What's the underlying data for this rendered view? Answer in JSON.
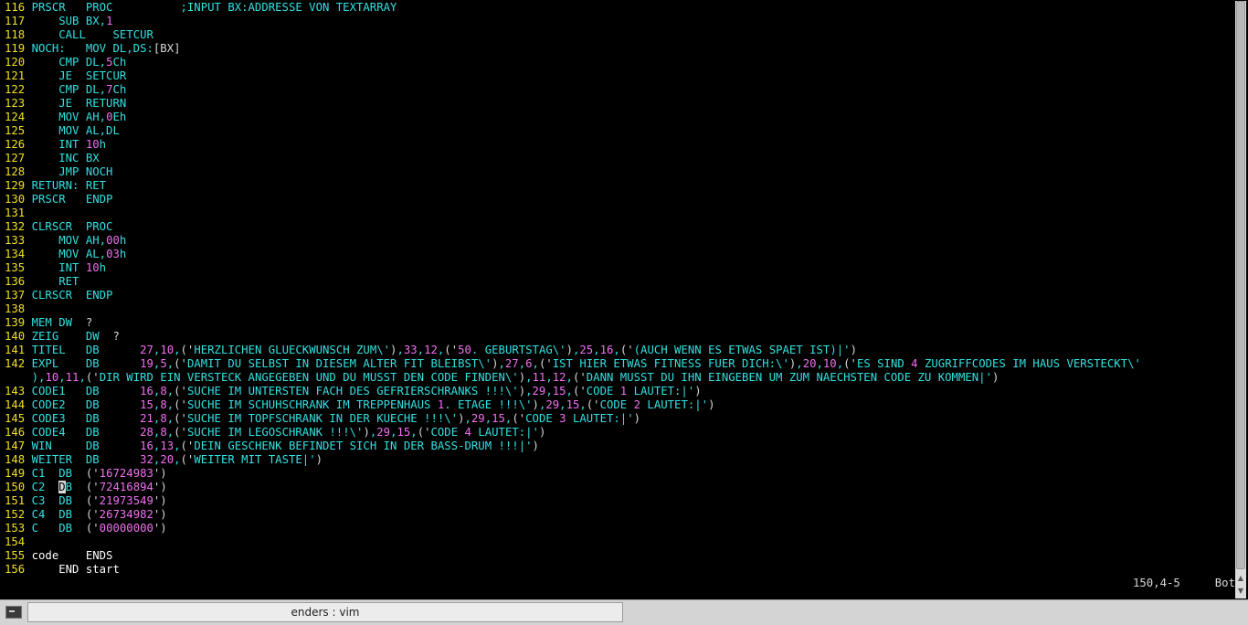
{
  "lines": [
    [
      [
        "num",
        "116 "
      ],
      [
        "k",
        "PRSCR   PROC          ;INPUT BX:ADDRESSE VON TEXTARRAY"
      ]
    ],
    [
      [
        "num",
        "117 "
      ],
      [
        "k",
        "    SUB BX,"
      ],
      [
        "s",
        "1"
      ]
    ],
    [
      [
        "num",
        "118 "
      ],
      [
        "k",
        "    CALL    SETCUR"
      ]
    ],
    [
      [
        "num",
        "119 "
      ],
      [
        "k",
        "NOCH:   MOV DL,DS:"
      ],
      [
        "p",
        "[BX]"
      ]
    ],
    [
      [
        "num",
        "120 "
      ],
      [
        "k",
        "    CMP DL,"
      ],
      [
        "s",
        "5"
      ],
      [
        "k",
        "Ch"
      ]
    ],
    [
      [
        "num",
        "121 "
      ],
      [
        "k",
        "    JE  SETCUR"
      ]
    ],
    [
      [
        "num",
        "122 "
      ],
      [
        "k",
        "    CMP DL,"
      ],
      [
        "s",
        "7"
      ],
      [
        "k",
        "Ch"
      ]
    ],
    [
      [
        "num",
        "123 "
      ],
      [
        "k",
        "    JE  RETURN"
      ]
    ],
    [
      [
        "num",
        "124 "
      ],
      [
        "k",
        "    MOV AH,"
      ],
      [
        "s",
        "0"
      ],
      [
        "k",
        "Eh"
      ]
    ],
    [
      [
        "num",
        "125 "
      ],
      [
        "k",
        "    MOV AL,DL"
      ]
    ],
    [
      [
        "num",
        "126 "
      ],
      [
        "k",
        "    INT "
      ],
      [
        "s",
        "10"
      ],
      [
        "k",
        "h"
      ]
    ],
    [
      [
        "num",
        "127 "
      ],
      [
        "k",
        "    INC BX"
      ]
    ],
    [
      [
        "num",
        "128 "
      ],
      [
        "k",
        "    JMP NOCH"
      ]
    ],
    [
      [
        "num",
        "129 "
      ],
      [
        "k",
        "RETURN: RET"
      ]
    ],
    [
      [
        "num",
        "130 "
      ],
      [
        "k",
        "PRSCR   ENDP"
      ]
    ],
    [
      [
        "num",
        "131 "
      ]
    ],
    [
      [
        "num",
        "132 "
      ],
      [
        "k",
        "CLRSCR  PROC"
      ]
    ],
    [
      [
        "num",
        "133 "
      ],
      [
        "k",
        "    MOV AH,"
      ],
      [
        "s",
        "00"
      ],
      [
        "k",
        "h"
      ]
    ],
    [
      [
        "num",
        "134 "
      ],
      [
        "k",
        "    MOV AL,"
      ],
      [
        "s",
        "03"
      ],
      [
        "k",
        "h"
      ]
    ],
    [
      [
        "num",
        "135 "
      ],
      [
        "k",
        "    INT "
      ],
      [
        "s",
        "10"
      ],
      [
        "k",
        "h"
      ]
    ],
    [
      [
        "num",
        "136 "
      ],
      [
        "k",
        "    RET"
      ]
    ],
    [
      [
        "num",
        "137 "
      ],
      [
        "k",
        "CLRSCR  ENDP"
      ]
    ],
    [
      [
        "num",
        "138 "
      ]
    ],
    [
      [
        "num",
        "139 "
      ],
      [
        "k",
        "MEM DW  "
      ],
      [
        "p",
        "?"
      ]
    ],
    [
      [
        "num",
        "140 "
      ],
      [
        "k",
        "ZEIG    DW  "
      ],
      [
        "p",
        "?"
      ]
    ],
    [
      [
        "num",
        "141 "
      ],
      [
        "k",
        "TITEL   DB      "
      ],
      [
        "s",
        "27"
      ],
      [
        "k",
        ","
      ],
      [
        "s",
        "10"
      ],
      [
        "k",
        ","
      ],
      [
        "p",
        "('"
      ],
      [
        "k",
        "HERZLICHEN GLUECKWUNSCH ZUM\\'"
      ],
      [
        "p",
        ")"
      ],
      [
        "k",
        ","
      ],
      [
        "s",
        "33"
      ],
      [
        "k",
        ","
      ],
      [
        "s",
        "12"
      ],
      [
        "k",
        ","
      ],
      [
        "p",
        "('"
      ],
      [
        "s",
        "50"
      ],
      [
        "k",
        ". GEBURTSTAG\\'"
      ],
      [
        "p",
        ")"
      ],
      [
        "k",
        ","
      ],
      [
        "s",
        "25"
      ],
      [
        "k",
        ","
      ],
      [
        "s",
        "16"
      ],
      [
        "k",
        ","
      ],
      [
        "p",
        "('"
      ],
      [
        "k",
        "(AUCH WENN ES ETWAS SPAET IST)|'"
      ],
      [
        "p",
        ")"
      ]
    ],
    [
      [
        "num",
        "142 "
      ],
      [
        "k",
        "EXPL    DB      "
      ],
      [
        "s",
        "19"
      ],
      [
        "k",
        ","
      ],
      [
        "s",
        "5"
      ],
      [
        "k",
        ","
      ],
      [
        "p",
        "('"
      ],
      [
        "k",
        "DAMIT DU SELBST IN DIESEM ALTER FIT BLEIBST\\'"
      ],
      [
        "p",
        ")"
      ],
      [
        "k",
        ","
      ],
      [
        "s",
        "27"
      ],
      [
        "k",
        ","
      ],
      [
        "s",
        "6"
      ],
      [
        "k",
        ","
      ],
      [
        "p",
        "('"
      ],
      [
        "k",
        "IST HIER ETWAS FITNESS FUER DICH:\\'"
      ],
      [
        "p",
        ")"
      ],
      [
        "k",
        ","
      ],
      [
        "s",
        "20"
      ],
      [
        "k",
        ","
      ],
      [
        "s",
        "10"
      ],
      [
        "k",
        ","
      ],
      [
        "p",
        "('"
      ],
      [
        "k",
        "ES SIND "
      ],
      [
        "s",
        "4"
      ],
      [
        "k",
        " ZUGRIFFCODES IM HAUS VERSTECKT\\'"
      ]
    ],
    [
      [
        "k",
        "    )"
      ],
      [
        "k",
        ","
      ],
      [
        "s",
        "10"
      ],
      [
        "k",
        ","
      ],
      [
        "s",
        "11"
      ],
      [
        "k",
        ","
      ],
      [
        "p",
        "('"
      ],
      [
        "k",
        "DIR WIRD EIN VERSTECK ANGEGEBEN UND DU MUSST DEN CODE FINDEN\\'"
      ],
      [
        "p",
        ")"
      ],
      [
        "k",
        ","
      ],
      [
        "s",
        "11"
      ],
      [
        "k",
        ","
      ],
      [
        "s",
        "12"
      ],
      [
        "k",
        ","
      ],
      [
        "p",
        "('"
      ],
      [
        "k",
        "DANN MUSST DU IHN EINGEBEN UM ZUM NAECHSTEN CODE ZU KOMMEN|'"
      ],
      [
        "p",
        ")"
      ]
    ],
    [
      [
        "num",
        "143 "
      ],
      [
        "k",
        "CODE1   DB      "
      ],
      [
        "s",
        "16"
      ],
      [
        "k",
        ","
      ],
      [
        "s",
        "8"
      ],
      [
        "k",
        ","
      ],
      [
        "p",
        "('"
      ],
      [
        "k",
        "SUCHE IM UNTERSTEN FACH DES GEFRIERSCHRANKS !!!\\'"
      ],
      [
        "p",
        ")"
      ],
      [
        "k",
        ","
      ],
      [
        "s",
        "29"
      ],
      [
        "k",
        ","
      ],
      [
        "s",
        "15"
      ],
      [
        "k",
        ","
      ],
      [
        "p",
        "('"
      ],
      [
        "k",
        "CODE "
      ],
      [
        "s",
        "1"
      ],
      [
        "k",
        " LAUTET:|'"
      ],
      [
        "p",
        ")"
      ]
    ],
    [
      [
        "num",
        "144 "
      ],
      [
        "k",
        "CODE2   DB      "
      ],
      [
        "s",
        "15"
      ],
      [
        "k",
        ","
      ],
      [
        "s",
        "8"
      ],
      [
        "k",
        ","
      ],
      [
        "p",
        "('"
      ],
      [
        "k",
        "SUCHE IM SCHUHSCHRANK IM TREPPENHAUS "
      ],
      [
        "s",
        "1"
      ],
      [
        "k",
        ". ETAGE !!!\\'"
      ],
      [
        "p",
        ")"
      ],
      [
        "k",
        ","
      ],
      [
        "s",
        "29"
      ],
      [
        "k",
        ","
      ],
      [
        "s",
        "15"
      ],
      [
        "k",
        ","
      ],
      [
        "p",
        "('"
      ],
      [
        "k",
        "CODE "
      ],
      [
        "s",
        "2"
      ],
      [
        "k",
        " LAUTET:|'"
      ],
      [
        "p",
        ")"
      ]
    ],
    [
      [
        "num",
        "145 "
      ],
      [
        "k",
        "CODE3   DB      "
      ],
      [
        "s",
        "21"
      ],
      [
        "k",
        ","
      ],
      [
        "s",
        "8"
      ],
      [
        "k",
        ","
      ],
      [
        "p",
        "('"
      ],
      [
        "k",
        "SUCHE IM TOPFSCHRANK IN DER KUECHE !!!\\'"
      ],
      [
        "p",
        ")"
      ],
      [
        "k",
        ","
      ],
      [
        "s",
        "29"
      ],
      [
        "k",
        ","
      ],
      [
        "s",
        "15"
      ],
      [
        "k",
        ","
      ],
      [
        "p",
        "('"
      ],
      [
        "k",
        "CODE "
      ],
      [
        "s",
        "3"
      ],
      [
        "k",
        " LAUTET:|'"
      ],
      [
        "p",
        ")"
      ]
    ],
    [
      [
        "num",
        "146 "
      ],
      [
        "k",
        "CODE4   DB      "
      ],
      [
        "s",
        "28"
      ],
      [
        "k",
        ","
      ],
      [
        "s",
        "8"
      ],
      [
        "k",
        ","
      ],
      [
        "p",
        "('"
      ],
      [
        "k",
        "SUCHE IM LEGOSCHRANK !!!\\'"
      ],
      [
        "p",
        ")"
      ],
      [
        "k",
        ","
      ],
      [
        "s",
        "29"
      ],
      [
        "k",
        ","
      ],
      [
        "s",
        "15"
      ],
      [
        "k",
        ","
      ],
      [
        "p",
        "('"
      ],
      [
        "k",
        "CODE "
      ],
      [
        "s",
        "4"
      ],
      [
        "k",
        " LAUTET:|'"
      ],
      [
        "p",
        ")"
      ]
    ],
    [
      [
        "num",
        "147 "
      ],
      [
        "k",
        "WIN     DB      "
      ],
      [
        "s",
        "16"
      ],
      [
        "k",
        ","
      ],
      [
        "s",
        "13"
      ],
      [
        "k",
        ","
      ],
      [
        "p",
        "('"
      ],
      [
        "k",
        "DEIN GESCHENK BEFINDET SICH IN DER BASS-DRUM !!!|'"
      ],
      [
        "p",
        ")"
      ]
    ],
    [
      [
        "num",
        "148 "
      ],
      [
        "k",
        "WEITER  DB      "
      ],
      [
        "s",
        "32"
      ],
      [
        "k",
        ","
      ],
      [
        "s",
        "20"
      ],
      [
        "k",
        ","
      ],
      [
        "p",
        "('"
      ],
      [
        "k",
        "WEITER MIT TASTE|'"
      ],
      [
        "p",
        ")"
      ]
    ],
    [
      [
        "num",
        "149 "
      ],
      [
        "k",
        "C1  DB  "
      ],
      [
        "p",
        "('"
      ],
      [
        "s",
        "16724983"
      ],
      [
        "p",
        "')"
      ]
    ],
    [
      [
        "num",
        "150 "
      ],
      [
        "k",
        "C2  "
      ],
      [
        "cur",
        "D"
      ],
      [
        "k",
        "B  "
      ],
      [
        "p",
        "('"
      ],
      [
        "s",
        "72416894"
      ],
      [
        "p",
        "')"
      ]
    ],
    [
      [
        "num",
        "151 "
      ],
      [
        "k",
        "C3  DB  "
      ],
      [
        "p",
        "('"
      ],
      [
        "s",
        "21973549"
      ],
      [
        "p",
        "')"
      ]
    ],
    [
      [
        "num",
        "152 "
      ],
      [
        "k",
        "C4  DB  "
      ],
      [
        "p",
        "('"
      ],
      [
        "s",
        "26734982"
      ],
      [
        "p",
        "')"
      ]
    ],
    [
      [
        "num",
        "153 "
      ],
      [
        "k",
        "C   DB  "
      ],
      [
        "p",
        "('"
      ],
      [
        "s",
        "00000000"
      ],
      [
        "p",
        "')"
      ]
    ],
    [
      [
        "num",
        "154 "
      ]
    ],
    [
      [
        "num",
        "155 "
      ],
      [
        "w",
        "code    ENDS"
      ]
    ],
    [
      [
        "num",
        "156 "
      ],
      [
        "w",
        "    END start"
      ]
    ]
  ],
  "status": {
    "position": "150,4-5",
    "scroll": "Bot"
  },
  "taskbar": {
    "task_title": "enders : vim"
  },
  "colors": {
    "linenr": "#f0e020",
    "keyword": "#33e0e0",
    "constant": "#f070f0",
    "punct": "#d8d8d8",
    "bg": "#000000"
  }
}
